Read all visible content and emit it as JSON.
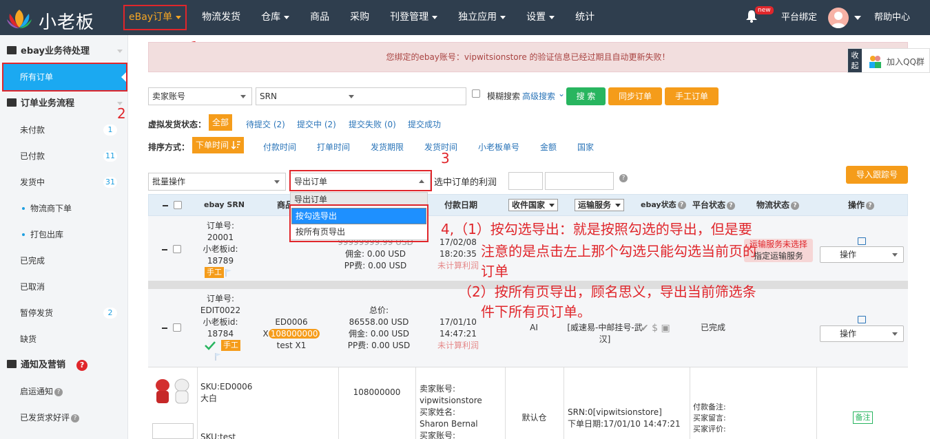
{
  "header": {
    "logo_text": "小老板",
    "nav": [
      "eBay订单",
      "物流发货",
      "仓库",
      "商品",
      "采购",
      "刊登管理",
      "独立应用",
      "设置",
      "统计"
    ],
    "nav_has_caret": [
      true,
      false,
      true,
      false,
      false,
      true,
      true,
      true,
      false
    ],
    "new_badge": "new",
    "bind": "平台绑定",
    "help": "帮助中心"
  },
  "sidebar": {
    "sec1": "ebay业务待处理",
    "all_orders": "所有订单",
    "sec2": "订单业务流程",
    "unpaid": "未付款",
    "unpaid_count": "1",
    "paid": "已付款",
    "paid_count": "11",
    "shipping": "发货中",
    "shipping_count": "31",
    "logistics": "物流商下单",
    "pack": "打包出库",
    "done": "已完成",
    "cancelled": "已取消",
    "paused": "暂停发货",
    "paused_count": "2",
    "oos": "缺货",
    "sec3": "通知及营销",
    "notice": "启运通知",
    "review": "已发货求好评"
  },
  "annotations": {
    "n1": "1",
    "n2": "2",
    "n3": "3"
  },
  "alert": "您绑定的ebay账号：vipwitsionstore 的验证信息已经过期且自动更新失败！",
  "qq": {
    "fold": "收起",
    "label": "加入QQ群"
  },
  "filter": {
    "seller": "卖家账号",
    "srn": "SRN",
    "fuzzy": "模糊搜索",
    "advanced": "高级搜索",
    "search": "搜 索",
    "sync": "同步订单",
    "manual": "手工订单",
    "virtual_label": "虚拟发货状态：",
    "virtual": [
      "全部",
      "待提交 (2)",
      "提交中 (2)",
      "提交失败 (0)",
      "提交成功"
    ],
    "sort_label": "排序方式：",
    "sort_active": "下单时间",
    "sort": [
      "付款时间",
      "打单时间",
      "发货期限",
      "发货时间",
      "小老板单号",
      "金额",
      "国家"
    ]
  },
  "batch": {
    "bulk": "批量操作",
    "export": "导出订单",
    "profit": "选中订单的利润",
    "import_track": "导入跟踪号"
  },
  "dropdown": {
    "head": "导出订单",
    "opt1": "按勾选导出",
    "opt2": "按所有页导出"
  },
  "table": {
    "h_srn": "ebay SRN",
    "h_goods": "商品",
    "h_paydate": "付款日期",
    "h_country": "收件国家",
    "h_ship": "运输服务",
    "h_ebay_status": "ebay状态",
    "h_platform": "平台状态",
    "h_logistics": "物流状态",
    "h_op": "操作"
  },
  "order1": {
    "no_label": "订单号:",
    "no": "20001",
    "xlb_label": "小老板id:",
    "xlb": "18789",
    "hand": "手工",
    "price": "99999999.99 USD",
    "commission": "佣金:  0.00 USD",
    "pp": "PP费:  0.00 USD",
    "date": "17/02/08 18:20:35",
    "profit": "未计算利润",
    "ship_warn": "运输服务未选择",
    "ship_link": "指定运输服务",
    "op": "操作"
  },
  "order2": {
    "no_label": "订单号:",
    "no": "EDIT0022",
    "xlb_label": "小老板id:",
    "xlb": "18784",
    "hand": "手工",
    "sku": "ED0006 X",
    "qty": "108000000",
    "item": "test X1",
    "total_label": "总价:",
    "total": "86558.00 USD",
    "commission": "佣金:  0.00 USD",
    "pp": "PP费:  0.00 USD",
    "date": "17/01/10 14:47:21",
    "profit": "未计算利润",
    "country": "AI",
    "ship": "[威速易-中邮挂号-武汉]",
    "platform": "已完成",
    "op": "操作"
  },
  "card": {
    "sku": "SKU:ED0006",
    "name": "大白",
    "qty": "108000000",
    "seller_label": "卖家账号:",
    "seller": "vipwitsionstore",
    "buyer_label": "买家姓名:",
    "buyer": "Sharon Bernal",
    "buyer_acct": "买家账号:",
    "warehouse": "默认仓",
    "srn": "SRN:0[vipwitsionstore]",
    "order_date": "下单日期:17/01/10 14:47:21",
    "pay_note": "付款备注:",
    "buyer_msg": "买家留言:",
    "buyer_review": "买家评价:",
    "note_btn": "备注",
    "sku2": "SKU:test"
  },
  "big_annotation": {
    "l1": "4,（1）按勾选导出：就是按照勾选的导出，但是要",
    "l2": "注意的是点击左上那个勾选只能勾选当前页的",
    "l3": "订单",
    "l4": "（2）按所有页导出，顾名思义，导出当前筛选条",
    "l5": "件下所有页订单。"
  },
  "colors": {
    "nav_bg": "#2f3e4e",
    "active": "#1ba9f1",
    "orange": "#f59c1a",
    "green": "#28b55f",
    "red": "#e0262b"
  }
}
